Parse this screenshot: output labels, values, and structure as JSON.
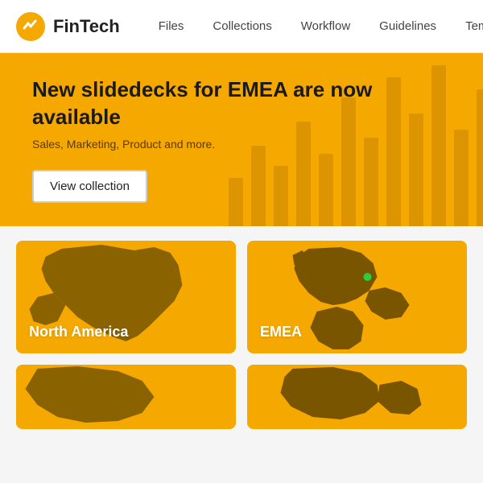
{
  "header": {
    "logo": "FinTech",
    "nav": [
      {
        "label": "Files",
        "id": "files"
      },
      {
        "label": "Collections",
        "id": "collections"
      },
      {
        "label": "Workflow",
        "id": "workflow"
      },
      {
        "label": "Guidelines",
        "id": "guidelines"
      },
      {
        "label": "Tem...",
        "id": "templates"
      }
    ]
  },
  "hero": {
    "title": "New slidedecks for EMEA are now available",
    "subtitle": "Sales, Marketing, Product and more.",
    "button": "View collection"
  },
  "cards": [
    {
      "id": "north-america",
      "label": "North America"
    },
    {
      "id": "emea",
      "label": "EMEA"
    },
    {
      "id": "card3",
      "label": ""
    },
    {
      "id": "card4",
      "label": ""
    }
  ]
}
